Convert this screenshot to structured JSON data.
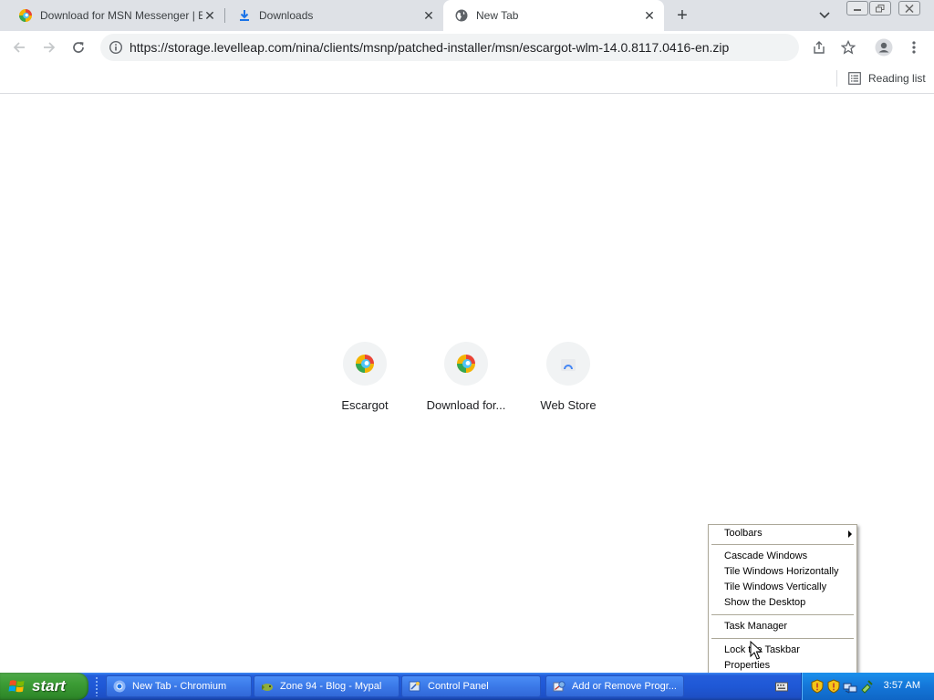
{
  "tabs": [
    {
      "title": "Download for MSN Messenger | Escargot",
      "favicon": "escargot-logo-icon",
      "active": false
    },
    {
      "title": "Downloads",
      "favicon": "download-icon",
      "active": false
    },
    {
      "title": "New Tab",
      "favicon": "globe-icon",
      "active": true
    }
  ],
  "toolbar": {
    "url": "https://storage.levelleap.com/nina/clients/msnp/patched-installer/msn/escargot-wlm-14.0.8117.0416-en.zip"
  },
  "bookmarks": {
    "reading_list": "Reading list"
  },
  "shortcuts": [
    {
      "label": "Escargot",
      "icon": "escargot-logo-icon"
    },
    {
      "label": "Download for...",
      "icon": "escargot-logo-icon"
    },
    {
      "label": "Web Store",
      "icon": "web-store-icon"
    }
  ],
  "context_menu": {
    "items": [
      {
        "label": "Toolbars",
        "submenu": true
      },
      {
        "label": "Cascade Windows"
      },
      {
        "label": "Tile Windows Horizontally"
      },
      {
        "label": "Tile Windows Vertically"
      },
      {
        "label": "Show the Desktop"
      },
      {
        "label": "Task Manager"
      },
      {
        "label": "Lock the Taskbar"
      },
      {
        "label": "Properties"
      }
    ]
  },
  "taskbar": {
    "start_label": "start",
    "buttons": [
      {
        "label": "New Tab - Chromium",
        "icon": "chromium-icon"
      },
      {
        "label": "Zone 94 - Blog - Mypal",
        "icon": "mypal-icon"
      },
      {
        "label": "Control Panel",
        "icon": "control-panel-icon"
      },
      {
        "label": "Add or Remove Progr...",
        "icon": "add-remove-programs-icon"
      }
    ],
    "clock": "3:57 AM"
  },
  "colors": {
    "tabstrip": "#dee1e6",
    "taskbar_blue": "#245edb",
    "start_green": "#3c9c35",
    "tray_blue": "#1476d8"
  }
}
